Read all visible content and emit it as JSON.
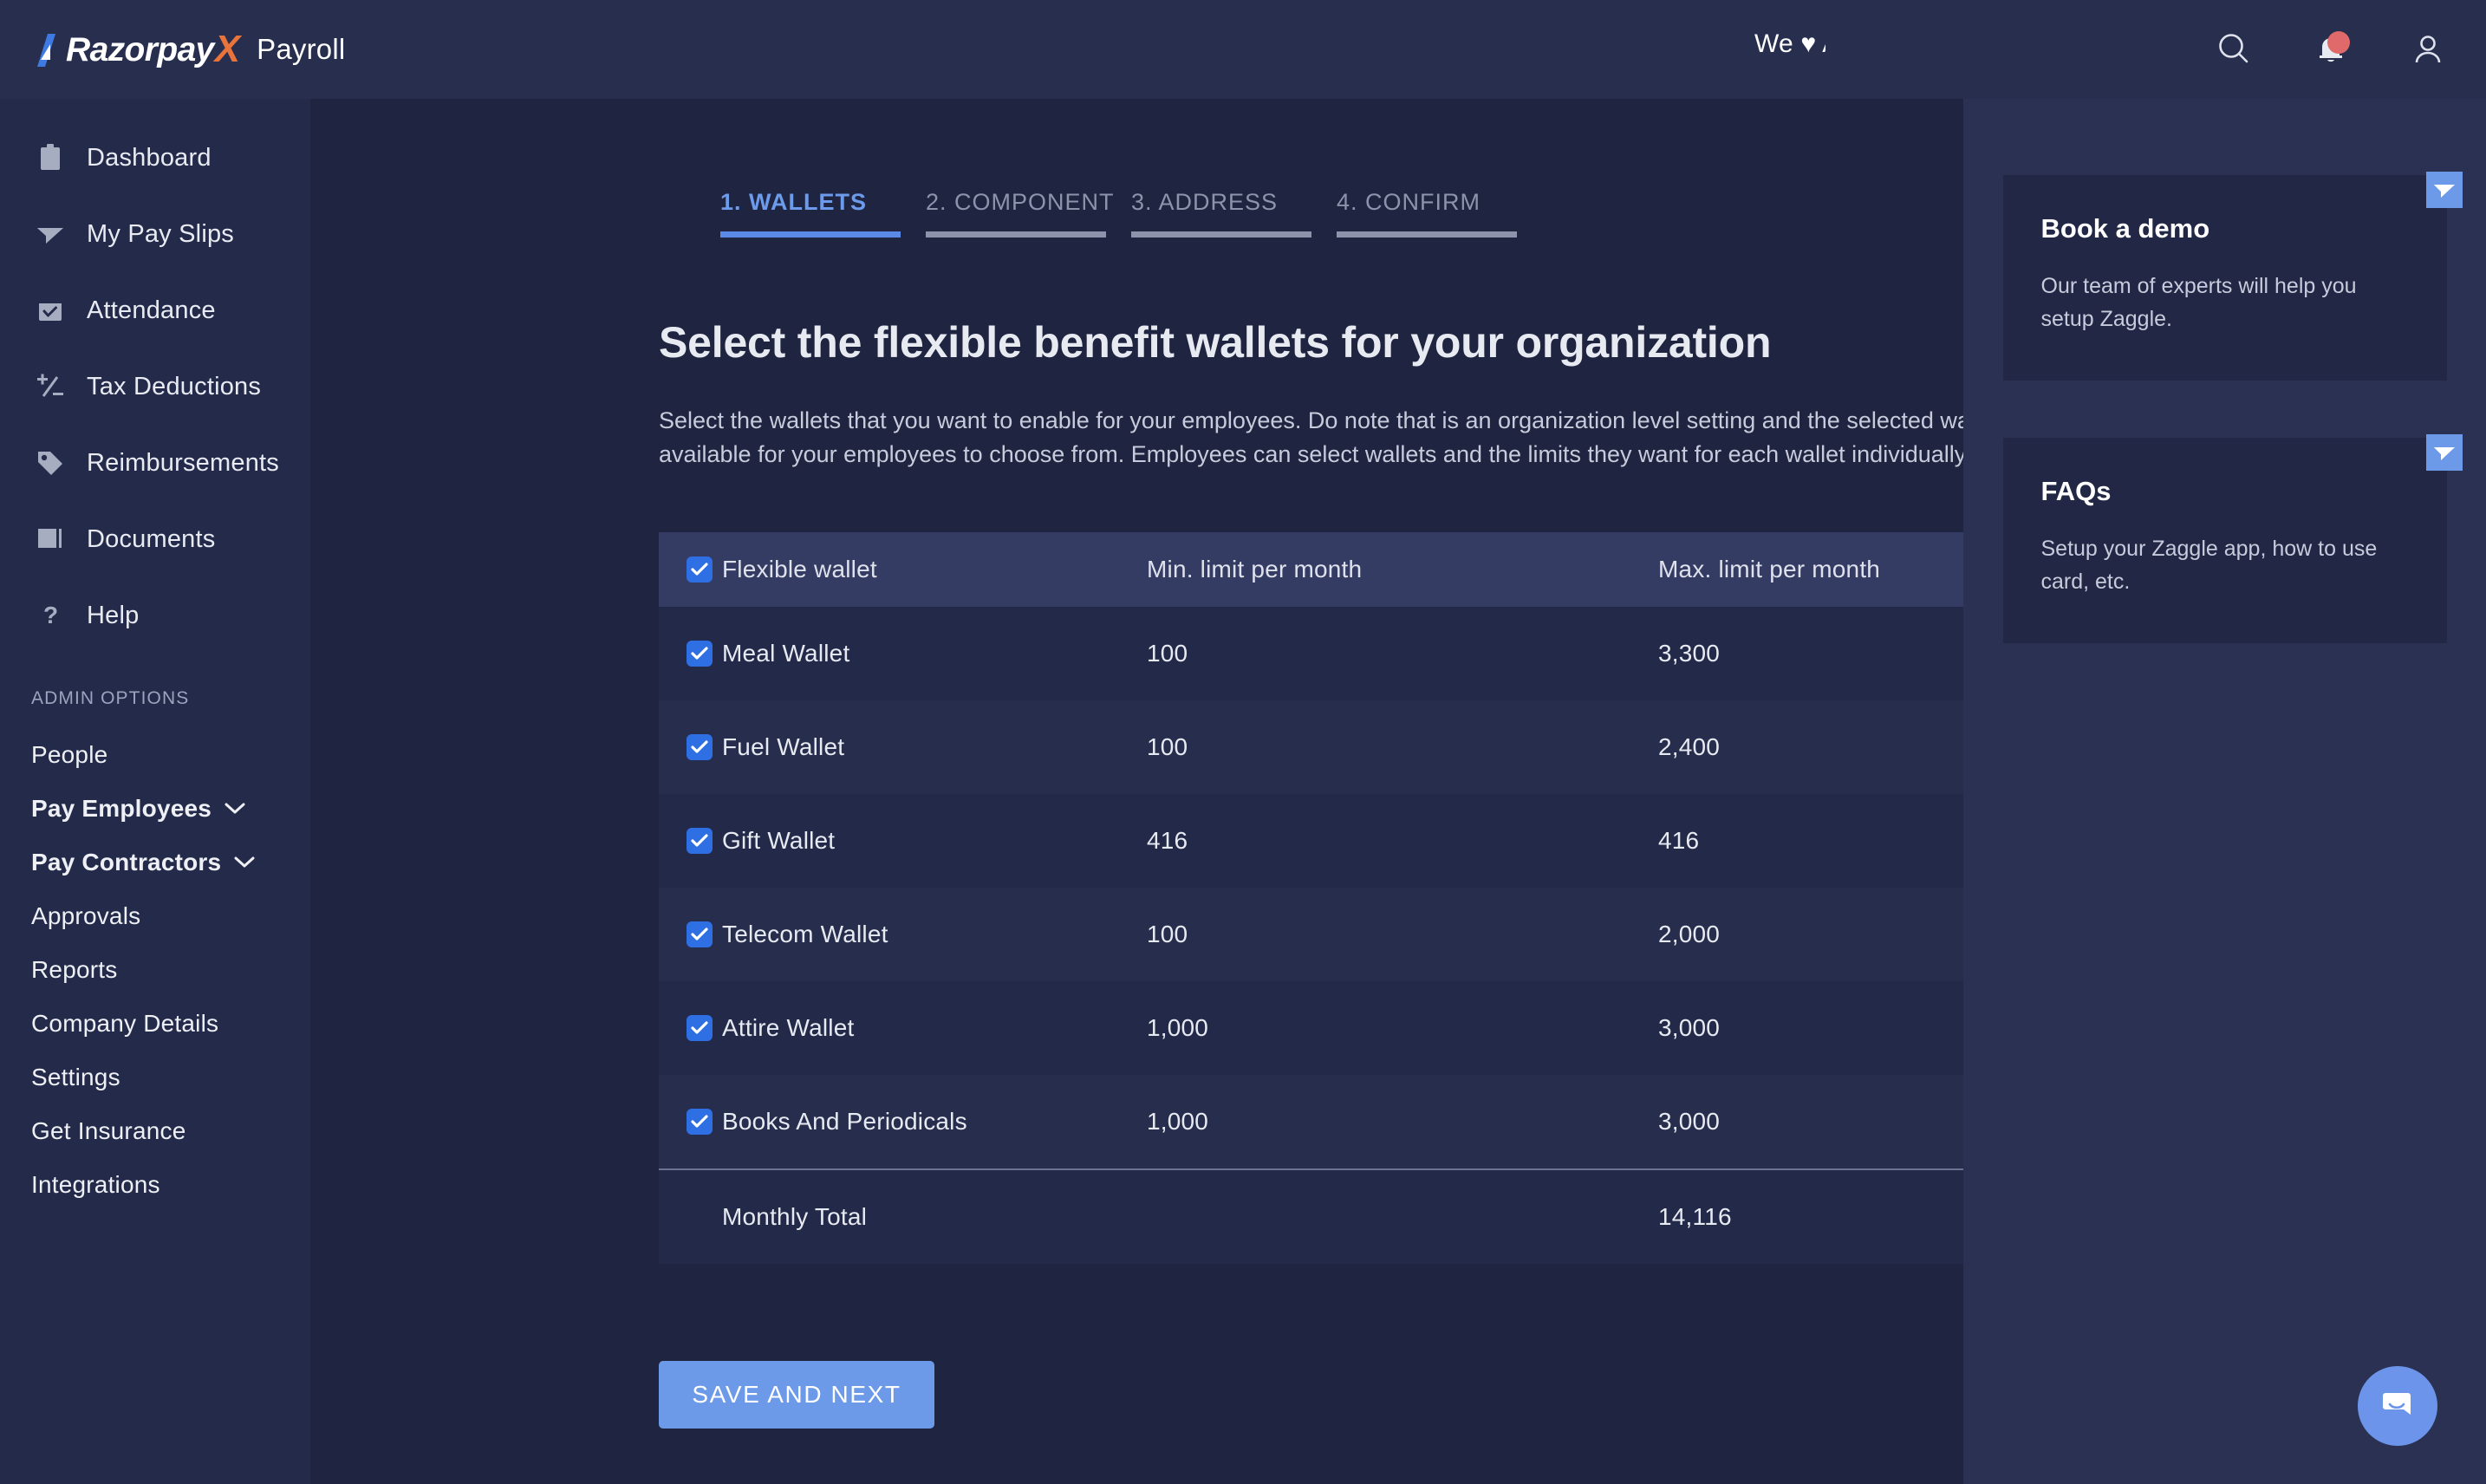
{
  "brand": {
    "logo_razorpay": "Razorpay",
    "logo_x": "X",
    "logo_suffix": "Payroll"
  },
  "topbar": {
    "tagline": "We ♥ Ap",
    "icons": [
      {
        "name": "search-icon",
        "label": "Search"
      },
      {
        "name": "bell-icon",
        "label": "Notifications"
      },
      {
        "name": "user-icon",
        "label": "Account"
      }
    ]
  },
  "sidebar": {
    "items": [
      {
        "label": "Dashboard",
        "icon": "clipboard-icon"
      },
      {
        "label": "My Pay Slips",
        "icon": "paper-plane-icon"
      },
      {
        "label": "Attendance",
        "icon": "checkbox-calendar-icon"
      },
      {
        "label": "Tax Deductions",
        "icon": "plus-minus-icon"
      },
      {
        "label": "Reimbursements",
        "icon": "tag-icon"
      },
      {
        "label": "Documents",
        "icon": "document-icon"
      },
      {
        "label": "Help",
        "icon": "question-mark-icon"
      }
    ],
    "section_title": "ADMIN OPTIONS",
    "admin_items": [
      {
        "label": "People",
        "bold": false,
        "chevron": false
      },
      {
        "label": "Pay Employees",
        "bold": true,
        "chevron": true
      },
      {
        "label": "Pay Contractors",
        "bold": true,
        "chevron": true
      },
      {
        "label": "Approvals",
        "bold": false,
        "chevron": false
      },
      {
        "label": "Reports",
        "bold": false,
        "chevron": false
      },
      {
        "label": "Company Details",
        "bold": false,
        "chevron": false
      },
      {
        "label": "Settings",
        "bold": false,
        "chevron": false
      },
      {
        "label": "Get Insurance",
        "bold": false,
        "chevron": false
      },
      {
        "label": "Integrations",
        "bold": false,
        "chevron": false
      }
    ]
  },
  "main": {
    "steps": [
      {
        "label": "1. WALLETS",
        "active": true
      },
      {
        "label": "2. COMPONENT",
        "active": false
      },
      {
        "label": "3. ADDRESS",
        "active": false
      },
      {
        "label": "4. CONFIRM",
        "active": false
      }
    ],
    "headline": "Select the flexible benefit wallets for your organization",
    "description": "Select the wallets that you want to enable for your employees. Do note that is an organization level setting and the selected wallets will be available for your employees to choose from. Employees can select wallets and the limits they want for each wallet individually.",
    "table": {
      "columns": [
        "Flexible wallet",
        "Min. limit per month",
        "Max. limit per month"
      ],
      "header_checked": true,
      "rows": [
        {
          "checked": true,
          "name": "Meal Wallet",
          "min": "100",
          "max": "3,300"
        },
        {
          "checked": true,
          "name": "Fuel Wallet",
          "min": "100",
          "max": "2,400"
        },
        {
          "checked": true,
          "name": "Gift Wallet",
          "min": "416",
          "max": "416"
        },
        {
          "checked": true,
          "name": "Telecom Wallet",
          "min": "100",
          "max": "2,000"
        },
        {
          "checked": true,
          "name": "Attire Wallet",
          "min": "1,000",
          "max": "3,000"
        },
        {
          "checked": true,
          "name": "Books And Periodicals",
          "min": "1,000",
          "max": "3,000"
        }
      ],
      "total_label": "Monthly Total",
      "total_min": "",
      "total_max": "14,116"
    },
    "save_button": "SAVE AND NEXT"
  },
  "rail": {
    "cards": [
      {
        "title": "Book a demo",
        "description": "Our team of experts will help you setup Zaggle.",
        "corner_icon": "paper-plane-icon"
      },
      {
        "title": "FAQs",
        "description": "Setup your Zaggle app, how to use card, etc.",
        "corner_icon": "paper-plane-icon"
      }
    ]
  },
  "chat_widget": {
    "icon": "chat-bubble-icon"
  },
  "colors": {
    "accent_blue": "#6c9ae8",
    "checkbox_blue": "#2f6fe4",
    "logo_orange": "#e8743b",
    "badge_red": "#e06a6a",
    "sidebar_bg": "#242b4a",
    "main_bg": "#1f2540",
    "rail_bg": "#2a3152",
    "table_header_bg": "#343c63"
  }
}
